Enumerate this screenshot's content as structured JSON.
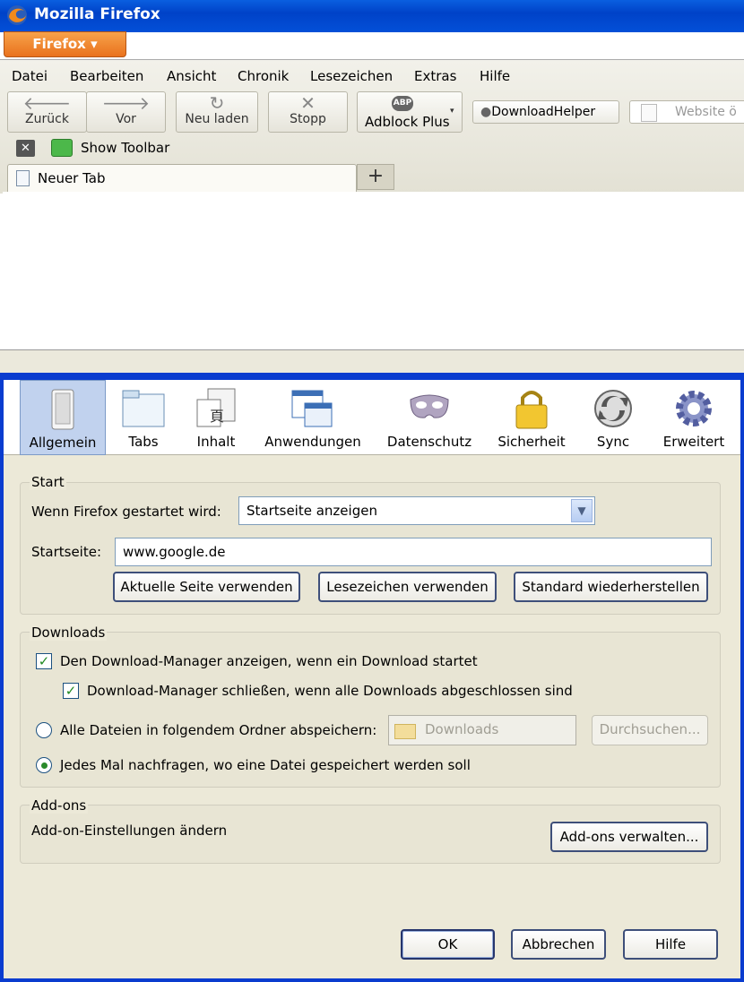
{
  "window": {
    "title": "Mozilla Firefox"
  },
  "firefox_button": "Firefox",
  "menu": [
    "Datei",
    "Bearbeiten",
    "Ansicht",
    "Chronik",
    "Lesezeichen",
    "Extras",
    "Hilfe"
  ],
  "nav": {
    "back": "Zurück",
    "forward": "Vor",
    "reload": "Neu laden",
    "stop": "Stopp",
    "adblock": "Adblock Plus",
    "adblock_badge": "ABP",
    "downloadhelper": "DownloadHelper",
    "url_placeholder": "Website ö"
  },
  "toolbar2": {
    "show_toolbar": "Show Toolbar"
  },
  "tab": {
    "title": "Neuer Tab",
    "new_tab_symbol": "+"
  },
  "prefs": {
    "panes": [
      "Allgemein",
      "Tabs",
      "Inhalt",
      "Anwendungen",
      "Datenschutz",
      "Sicherheit",
      "Sync",
      "Erweitert"
    ],
    "selected_pane": "Allgemein",
    "start": {
      "legend": "Start",
      "when_label": "Wenn Firefox gestartet wird:",
      "when_value": "Startseite anzeigen",
      "homepage_label": "Startseite:",
      "homepage_value": "www.google.de",
      "btn_current": "Aktuelle Seite verwenden",
      "btn_bookmark": "Lesezeichen verwenden",
      "btn_default": "Standard wiederherstellen"
    },
    "downloads": {
      "legend": "Downloads",
      "show_manager": "Den Download-Manager anzeigen, wenn ein Download startet",
      "close_manager": "Download-Manager schließen, wenn alle Downloads abgeschlossen sind",
      "save_to": "Alle Dateien in folgendem Ordner abspeichern:",
      "folder": "Downloads",
      "browse": "Durchsuchen...",
      "ask": "Jedes Mal nachfragen, wo eine Datei gespeichert werden soll",
      "show_manager_checked": true,
      "close_manager_checked": true,
      "selected_option": "ask"
    },
    "addons": {
      "legend": "Add-ons",
      "desc": "Add-on-Einstellungen ändern",
      "btn": "Add-ons verwalten..."
    },
    "footer": {
      "ok": "OK",
      "cancel": "Abbrechen",
      "help": "Hilfe"
    }
  },
  "colors": {
    "titlebar": "#0052d6",
    "firefox_button": "#e9721d",
    "dialog_bg": "#ece9d8",
    "selected_pane": "#c1d2ee"
  }
}
